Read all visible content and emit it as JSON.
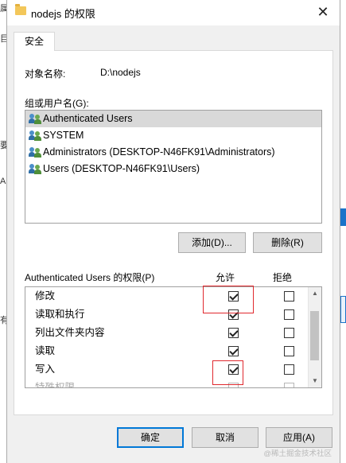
{
  "background": {
    "left_fragments": [
      "属",
      "目",
      "要",
      "Au",
      "有"
    ],
    "bottom_fragment": "写入"
  },
  "dialog": {
    "title": "nodejs 的权限",
    "close_glyph": "✕",
    "tab": "安全",
    "object_label": "对象名称:",
    "object_value": "D:\\nodejs",
    "group_label": "组或用户名(G):",
    "users": [
      {
        "name": "Authenticated Users",
        "selected": true
      },
      {
        "name": "SYSTEM",
        "selected": false
      },
      {
        "name": "Administrators (DESKTOP-N46FK91\\Administrators)",
        "selected": false
      },
      {
        "name": "Users (DESKTOP-N46FK91\\Users)",
        "selected": false
      }
    ],
    "add_button": "添加(D)...",
    "remove_button": "删除(R)",
    "perm_label": "Authenticated Users 的权限(P)",
    "allow_header": "允许",
    "deny_header": "拒绝",
    "permissions": [
      {
        "name": "修改",
        "allow": true,
        "deny": false
      },
      {
        "name": "读取和执行",
        "allow": true,
        "deny": false
      },
      {
        "name": "列出文件夹内容",
        "allow": true,
        "deny": false
      },
      {
        "name": "读取",
        "allow": true,
        "deny": false
      },
      {
        "name": "写入",
        "allow": true,
        "deny": false
      },
      {
        "name": "特殊权限",
        "allow": false,
        "deny": false
      }
    ],
    "ok_button": "确定",
    "cancel_button": "取消",
    "apply_button": "应用(A)",
    "watermark": "@稀土掘金技术社区"
  },
  "colors": {
    "highlight_box": "#e0282e",
    "default_button_border": "#0078d7"
  }
}
